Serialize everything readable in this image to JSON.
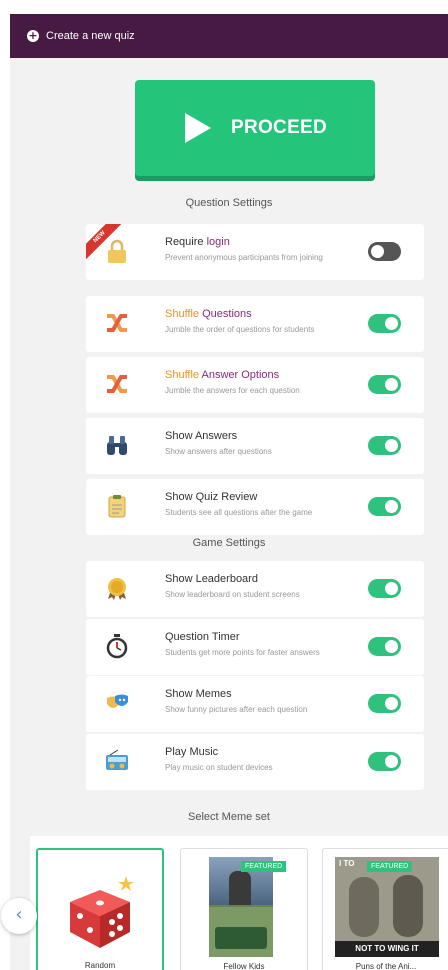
{
  "topbar": {
    "create_label": "Create a new quiz",
    "plus_icon": "plus-circle-icon"
  },
  "proceed": {
    "label": "PROCEED",
    "color": "#24c47b"
  },
  "sections": {
    "question_settings": "Question Settings",
    "game_settings": "Game Settings",
    "meme_set": "Select Meme set"
  },
  "settings": [
    {
      "title_plain": "Require ",
      "title_accent": "login",
      "accent_position": "after",
      "desc": "Prevent anonymous participants from joining",
      "enabled": false,
      "badge": "NEW",
      "icon": "lock-icon"
    },
    {
      "title_accent": "Shuffle",
      "title_plain": " Questions",
      "accent_position": "before",
      "desc": "Jumble the order of questions for students",
      "enabled": true,
      "icon": "shuffle-icon"
    },
    {
      "title_accent": "Shuffle",
      "title_plain": " Answer Options",
      "accent_position": "before",
      "desc": "Jumble the answers for each question",
      "enabled": true,
      "icon": "shuffle-icon"
    },
    {
      "title_accent": "Show Answers",
      "title_plain": "",
      "desc": "Show answers after questions",
      "enabled": true,
      "icon": "binoculars-icon"
    },
    {
      "title_accent": "Show Quiz Review",
      "title_plain": "",
      "desc": "Students see all questions after the game",
      "enabled": true,
      "icon": "clipboard-icon"
    },
    {
      "title_accent": "Show Leaderboard",
      "title_plain": "",
      "desc": "Show leaderboard on student screens",
      "enabled": true,
      "icon": "medal-icon"
    },
    {
      "title_accent": "Question Timer",
      "title_plain": "",
      "desc": "Students get more points for faster answers",
      "enabled": true,
      "icon": "stopwatch-icon"
    },
    {
      "title_accent": "Show Memes",
      "title_plain": "",
      "desc": "Show funny pictures after each question",
      "enabled": true,
      "icon": "theater-masks-icon"
    },
    {
      "title_accent": "Play Music",
      "title_plain": "",
      "desc": "Play music on student devices",
      "enabled": true,
      "icon": "radio-icon"
    }
  ],
  "memes": [
    {
      "caption": "Random",
      "selected": true
    },
    {
      "caption": "Fellow Kids",
      "badge": "FEATURED"
    },
    {
      "caption": "Puns of the Ani...",
      "badge": "FEATURED",
      "image_top_text": "I TO",
      "image_bottom_text": "NOT TO WING IT"
    }
  ],
  "back_icon": "chevron-left-icon"
}
